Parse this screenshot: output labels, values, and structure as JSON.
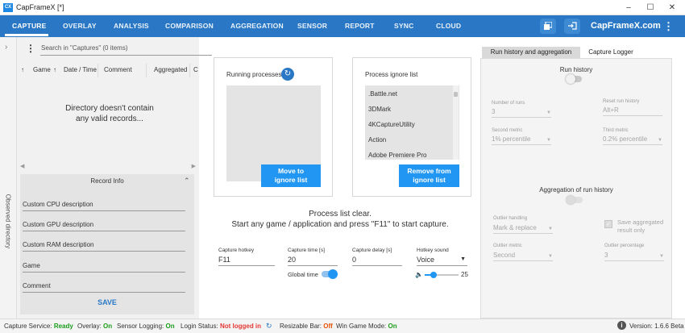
{
  "window": {
    "title": "CapFrameX [*]",
    "app_icon": "CX"
  },
  "nav": {
    "tabs": [
      {
        "label": "CAPTURE"
      },
      {
        "label": "OVERLAY"
      },
      {
        "label": "ANALYSIS"
      },
      {
        "label": "COMPARISON"
      },
      {
        "label": "AGGREGATION"
      },
      {
        "label": "SENSOR"
      },
      {
        "label": "REPORT"
      },
      {
        "label": "SYNC"
      },
      {
        "label": "CLOUD"
      }
    ],
    "active_tab": "CAPTURE",
    "brand": "CapFrameX.com"
  },
  "sidebar": {
    "label": "Observed directory"
  },
  "captures": {
    "search_placeholder": "Search in \"Captures\" (0 items)",
    "columns": [
      "Game",
      "Date / Time",
      "Comment",
      "Aggregated",
      "C"
    ],
    "empty_message_line1": "Directory doesn't contain",
    "empty_message_line2": "any valid records...",
    "record_info": {
      "title": "Record Info",
      "fields": [
        {
          "label": "Custom CPU description"
        },
        {
          "label": "Custom GPU description"
        },
        {
          "label": "Custom RAM description"
        },
        {
          "label": "Game"
        },
        {
          "label": "Comment"
        }
      ],
      "save_label": "SAVE"
    }
  },
  "processes": {
    "running_title": "Running processes",
    "move_btn_line1": "Move to",
    "move_btn_line2": "ignore list",
    "ignore_title": "Process ignore list",
    "ignore_items": [
      ".Battle.net",
      "3DMark",
      "4KCaptureUtility",
      "Action",
      "Adobe Premiere Pro"
    ],
    "remove_btn_line1": "Remove from",
    "remove_btn_line2": "ignore list"
  },
  "message": {
    "line1": "Process list clear.",
    "line2": "Start any game / application and press \"F11\" to start capture."
  },
  "capture_settings": {
    "hotkey_label": "Capture hotkey",
    "hotkey_value": "F11",
    "time_label": "Capture time [s]",
    "time_value": "20",
    "delay_label": "Capture delay [s]",
    "delay_value": "0",
    "sound_label": "Hotkey sound",
    "sound_value": "Voice",
    "global_time_label": "Global time",
    "global_time_on": true,
    "volume_value": "25",
    "volume_fraction": 0.25
  },
  "right": {
    "tab1": "Run history and aggregation",
    "tab2": "Capture Logger",
    "run_history_label": "Run history",
    "number_of_runs_label": "Number of runs",
    "number_of_runs_value": "3",
    "reset_label": "Reset run history",
    "reset_value": "Alt+R",
    "second_metric_label": "Second metric",
    "second_metric_value": "1% percentile",
    "third_metric_label": "Third metric",
    "third_metric_value": "0.2% percentile",
    "aggregation_label": "Aggregation of run history",
    "outlier_handling_label": "Outlier handling",
    "outlier_handling_value": "Mark & replace",
    "save_aggregated_line1": "Save aggregated",
    "save_aggregated_line2": "result only",
    "outlier_metric_label": "Outlier metric",
    "outlier_metric_value": "Second",
    "outlier_percentage_label": "Outlier percentage",
    "outlier_percentage_value": "3"
  },
  "status": {
    "capture_service_label": "Capture Service:",
    "capture_service_value": "Ready",
    "overlay_label": "Overlay:",
    "overlay_value": "On",
    "sensor_label": "Sensor Logging:",
    "sensor_value": "On",
    "login_label": "Login Status:",
    "login_value": "Not logged in",
    "resizable_label": "Resizable Bar:",
    "resizable_value": "Off",
    "wingame_label": "Win Game Mode:",
    "wingame_value": "On",
    "version_label": "Version:",
    "version_value": "1.6.6 Beta"
  },
  "colors": {
    "accent": "#2a78c5",
    "button": "#2196f3",
    "ok": "#1a9c1a",
    "bad": "#e53935",
    "warn": "#e65100"
  }
}
